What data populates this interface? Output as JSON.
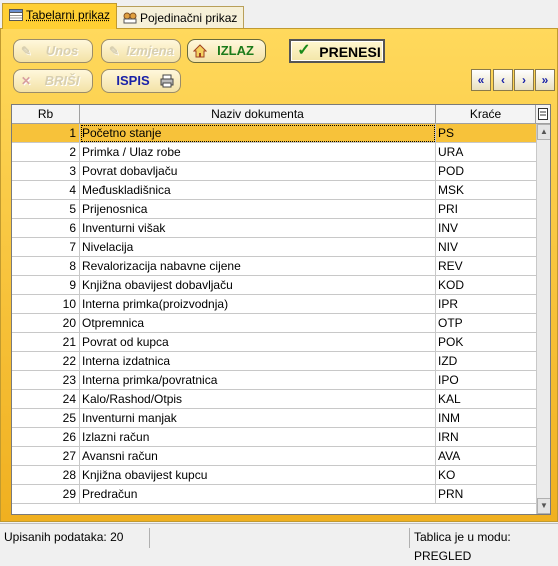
{
  "tabs": [
    {
      "label": "Tabelarni prikaz",
      "active": true
    },
    {
      "label": "Pojedinačni prikaz",
      "active": false
    }
  ],
  "toolbar": {
    "unos": "Unos",
    "izmjena": "Izmjena",
    "izlaz": "IZLAZ",
    "prenesi": "PRENESI",
    "brisi": "BRIŠI",
    "ispis": "ISPIS"
  },
  "nav": [
    "«",
    "‹",
    "›",
    "»"
  ],
  "grid": {
    "headers": {
      "rb": "Rb",
      "naziv": "Naziv dokumenta",
      "krace": "Kraće"
    },
    "rows": [
      {
        "rb": "1",
        "naziv": "Početno stanje",
        "krace": "PS"
      },
      {
        "rb": "2",
        "naziv": "Primka / Ulaz robe",
        "krace": "URA"
      },
      {
        "rb": "3",
        "naziv": "Povrat dobavljaču",
        "krace": "POD"
      },
      {
        "rb": "4",
        "naziv": "Međuskladišnica",
        "krace": "MSK"
      },
      {
        "rb": "5",
        "naziv": "Prijenosnica",
        "krace": "PRI"
      },
      {
        "rb": "6",
        "naziv": "Inventurni višak",
        "krace": "INV"
      },
      {
        "rb": "7",
        "naziv": "Nivelacija",
        "krace": "NIV"
      },
      {
        "rb": "8",
        "naziv": "Revalorizacija nabavne cijene",
        "krace": "REV"
      },
      {
        "rb": "9",
        "naziv": "Knjižna obavijest dobavljaču",
        "krace": "KOD"
      },
      {
        "rb": "10",
        "naziv": "Interna primka(proizvodnja)",
        "krace": "IPR"
      },
      {
        "rb": "20",
        "naziv": "Otpremnica",
        "krace": "OTP"
      },
      {
        "rb": "21",
        "naziv": "Povrat od kupca",
        "krace": "POK"
      },
      {
        "rb": "22",
        "naziv": "Interna izdatnica",
        "krace": "IZD"
      },
      {
        "rb": "23",
        "naziv": "Interna primka/povratnica",
        "krace": "IPO"
      },
      {
        "rb": "24",
        "naziv": "Kalo/Rashod/Otpis",
        "krace": "KAL"
      },
      {
        "rb": "25",
        "naziv": "Inventurni manjak",
        "krace": "INM"
      },
      {
        "rb": "26",
        "naziv": "Izlazni račun",
        "krace": "IRN"
      },
      {
        "rb": "27",
        "naziv": "Avansni račun",
        "krace": "AVA"
      },
      {
        "rb": "28",
        "naziv": "Knjižna obavijest kupcu",
        "krace": "KO"
      },
      {
        "rb": "29",
        "naziv": "Predračun",
        "krace": "PRN"
      }
    ]
  },
  "status": {
    "count": "Upisanih podataka: 20",
    "mode": "Tablica je u modu: PREGLED"
  }
}
